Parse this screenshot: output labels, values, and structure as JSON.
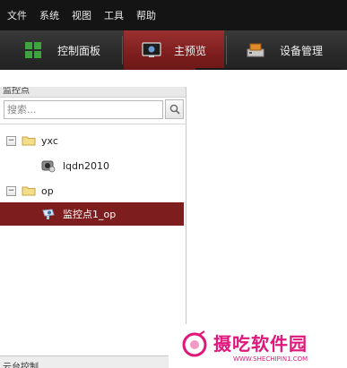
{
  "menu": [
    "文件",
    "系统",
    "视图",
    "工具",
    "帮助"
  ],
  "toolbar": {
    "control_panel": "控制面板",
    "main_preview": "主预览",
    "device_manage": "设备管理"
  },
  "panel": {
    "title": "监控点",
    "search_placeholder": "搜索...",
    "bottom_label": "云台控制"
  },
  "tree": {
    "group1": "yxc",
    "group1_item": "lqdn2010",
    "group2": "op",
    "group2_item": "监控点1_op"
  },
  "watermark": {
    "name": "摄吃软件园",
    "url": "WWW.SHECHIPIN1.COM"
  },
  "colors": {
    "accent": "#7e1d1d",
    "menubar": "#141414",
    "watermark": "#e0167a"
  },
  "icons": {
    "control_panel": "grid-icon",
    "main_preview": "monitor-icon",
    "device_manage": "device-icon",
    "search": "search-icon",
    "folder": "folder-icon",
    "camera": "camera-icon"
  }
}
